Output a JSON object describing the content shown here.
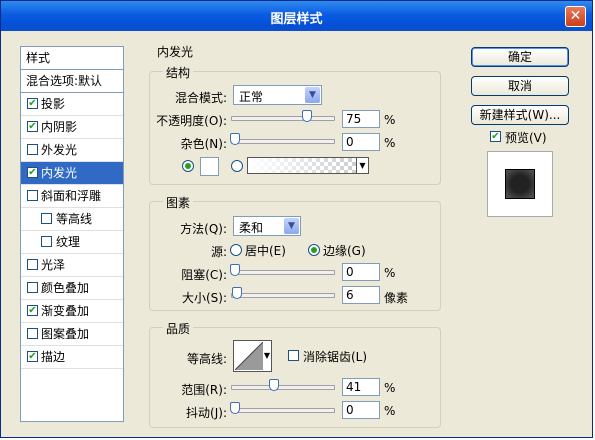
{
  "window": {
    "title": "图层样式",
    "close_glyph": "✕"
  },
  "sidebar": {
    "header": "样式",
    "blend_options": "混合选项:默认",
    "items": [
      {
        "label": "投影",
        "checked": true,
        "selected": false,
        "sub": false
      },
      {
        "label": "内阴影",
        "checked": true,
        "selected": false,
        "sub": false
      },
      {
        "label": "外发光",
        "checked": false,
        "selected": false,
        "sub": false
      },
      {
        "label": "内发光",
        "checked": true,
        "selected": true,
        "sub": false
      },
      {
        "label": "斜面和浮雕",
        "checked": false,
        "selected": false,
        "sub": false
      },
      {
        "label": "等高线",
        "checked": false,
        "selected": false,
        "sub": true
      },
      {
        "label": "纹理",
        "checked": false,
        "selected": false,
        "sub": true
      },
      {
        "label": "光泽",
        "checked": false,
        "selected": false,
        "sub": false
      },
      {
        "label": "颜色叠加",
        "checked": false,
        "selected": false,
        "sub": false
      },
      {
        "label": "渐变叠加",
        "checked": true,
        "selected": false,
        "sub": false
      },
      {
        "label": "图案叠加",
        "checked": false,
        "selected": false,
        "sub": false
      },
      {
        "label": "描边",
        "checked": true,
        "selected": false,
        "sub": false
      }
    ]
  },
  "panel": {
    "title": "内发光",
    "structure": {
      "title": "结构",
      "blend_mode_label": "混合模式:",
      "blend_mode_value": "正常",
      "opacity_label": "不透明度(O):",
      "opacity_value": "75",
      "opacity_unit": "%",
      "noise_label": "杂色(N):",
      "noise_value": "0",
      "noise_unit": "%",
      "color_mode": "solid"
    },
    "elements": {
      "title": "图素",
      "method_label": "方法(Q):",
      "method_value": "柔和",
      "source_label": "源:",
      "source_center": "居中(E)",
      "source_edge": "边缘(G)",
      "source_selected": "edge",
      "choke_label": "阻塞(C):",
      "choke_value": "0",
      "choke_unit": "%",
      "size_label": "大小(S):",
      "size_value": "6",
      "size_unit": "像素"
    },
    "quality": {
      "title": "品质",
      "contour_label": "等高线:",
      "antialias_label": "消除锯齿(L)",
      "antialias_checked": false,
      "range_label": "范围(R):",
      "range_value": "41",
      "range_unit": "%",
      "jitter_label": "抖动(J):",
      "jitter_value": "0",
      "jitter_unit": "%"
    }
  },
  "buttons": {
    "ok": "确定",
    "cancel": "取消",
    "new_style": "新建样式(W)...",
    "preview_label": "预览(V)",
    "preview_checked": true
  },
  "colors": {
    "title_bar": "#0b5be0",
    "selection": "#316ac5",
    "check_mark": "#21a121"
  }
}
